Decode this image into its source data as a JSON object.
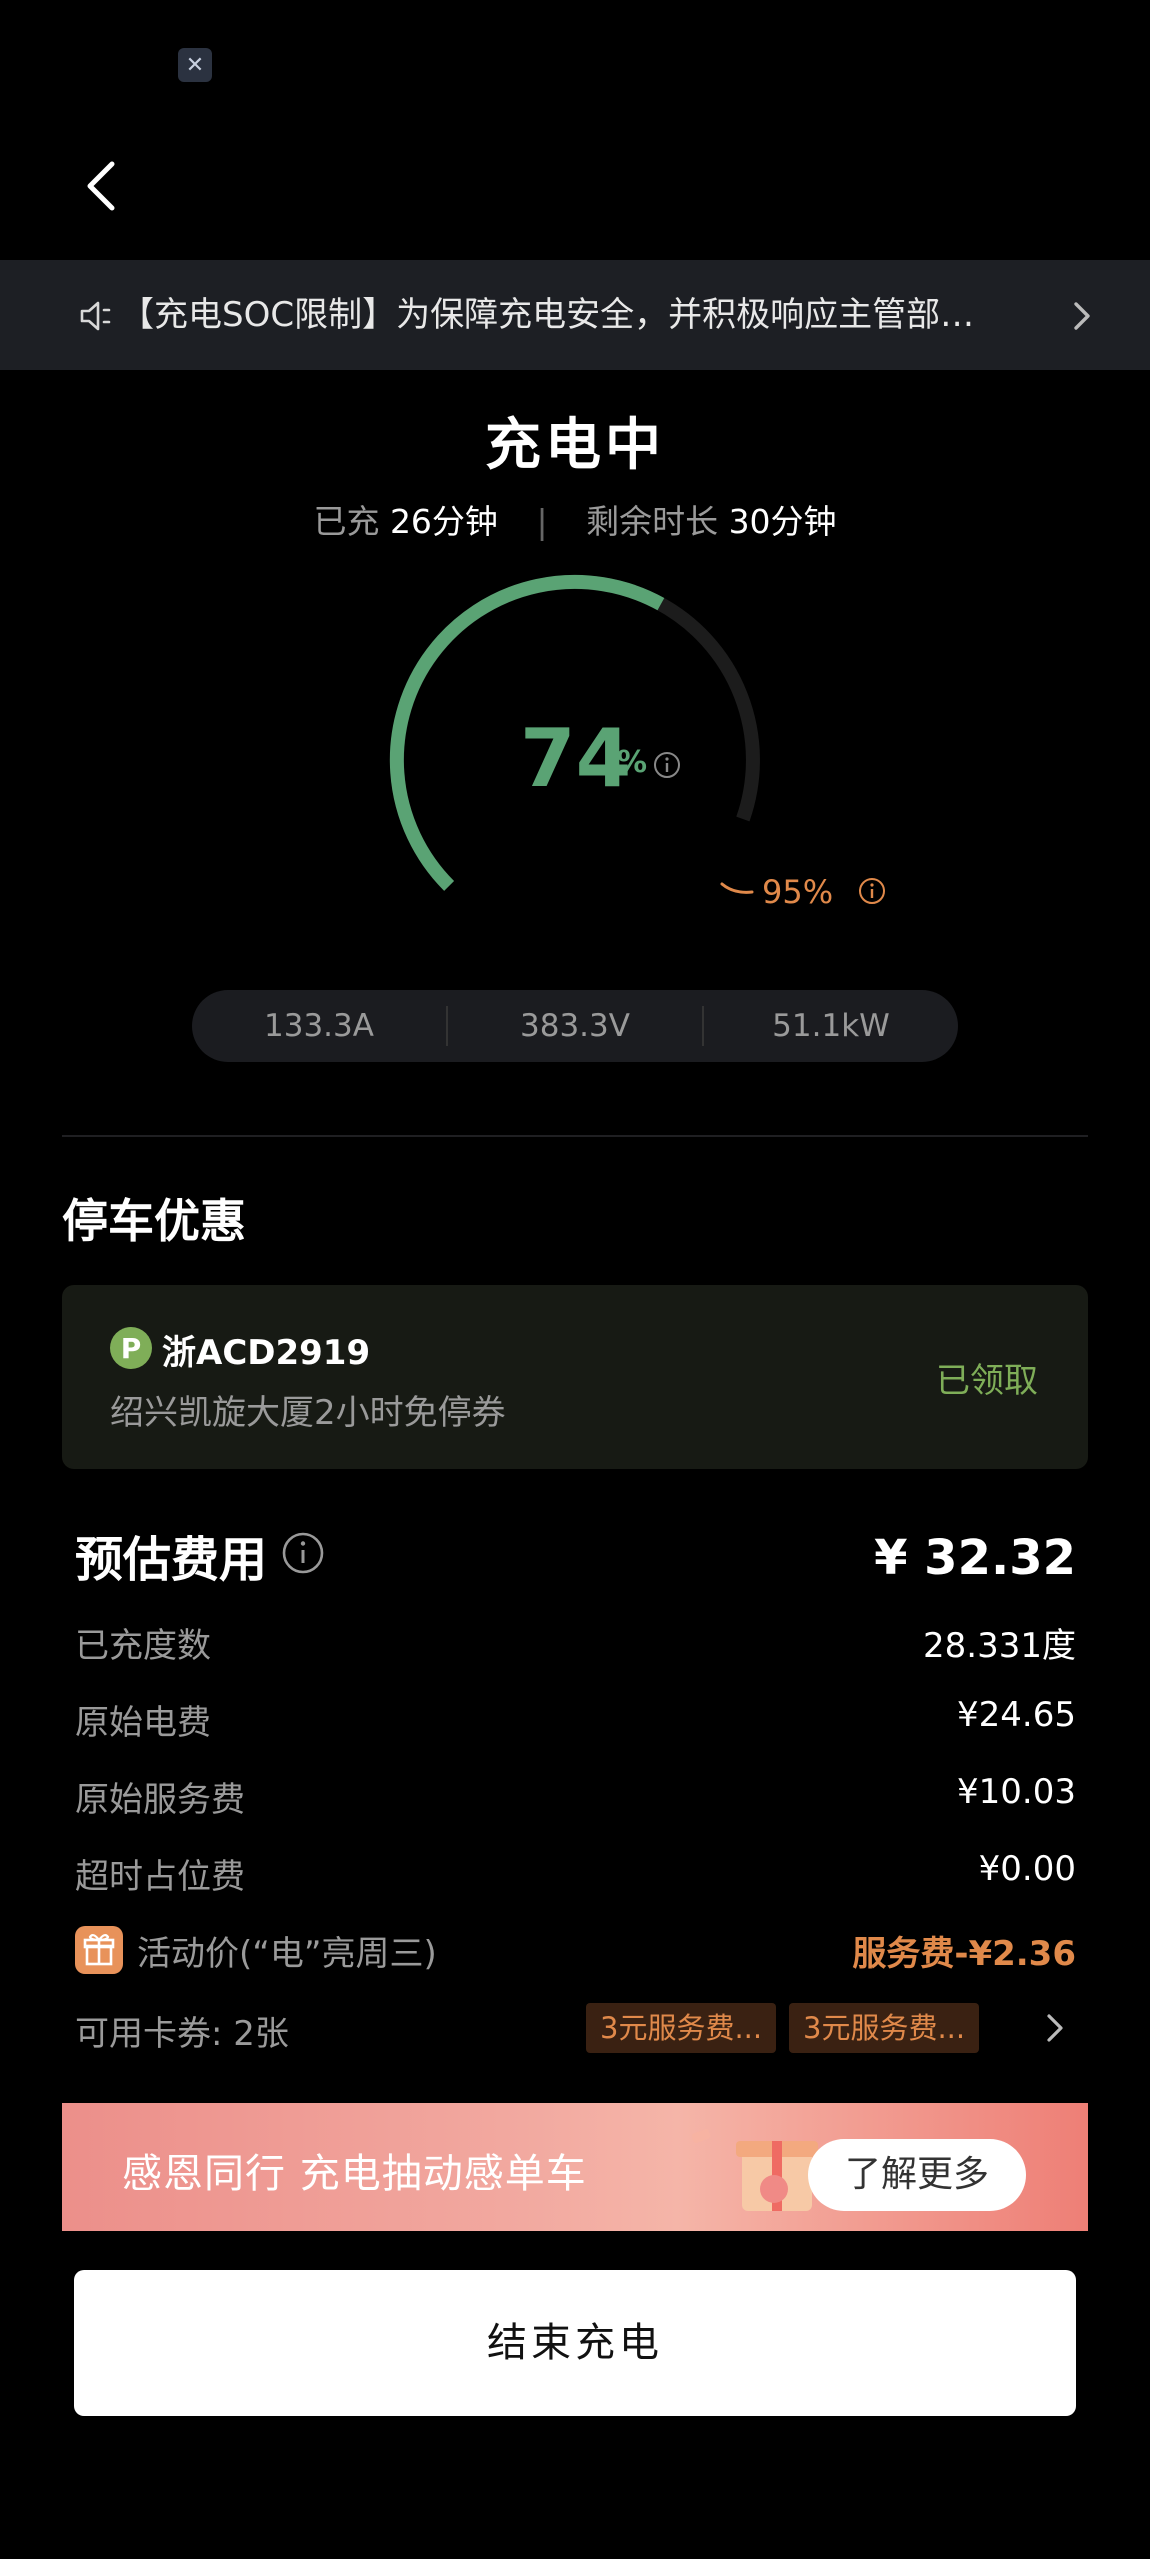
{
  "status_bar": {
    "app_icon": "close-x-icon"
  },
  "notice": {
    "text": "【充电SOC限制】为保障充电安全，并积极响应主管部…",
    "icons": {
      "leading": "speaker-icon",
      "trailing": "chevron-right-icon"
    }
  },
  "charging": {
    "status": "充电中",
    "charged_label": "已充",
    "charged_value": "26分钟",
    "separator": "|",
    "remaining_label": "剩余时长",
    "remaining_value": "30分钟",
    "soc_percent": 74,
    "soc_value": "74",
    "soc_unit": "%",
    "limit_percent": 95,
    "limit_text": "95%",
    "colors": {
      "progress": "#5aa374",
      "track": "#1c1c1c",
      "limit": "#e0894a"
    }
  },
  "metrics": {
    "current": "133.3A",
    "voltage": "383.3V",
    "power": "51.1kW"
  },
  "parking": {
    "title": "停车优惠",
    "badge": "P",
    "plate": "浙ACD2919",
    "coupon": "绍兴凯旋大厦2小时免停券",
    "status": "已领取"
  },
  "fees": {
    "title": "预估费用",
    "total": "¥ 32.32",
    "rows": [
      {
        "label": "已充度数",
        "value": "28.331度"
      },
      {
        "label": "原始电费",
        "value": "¥24.65"
      },
      {
        "label": "原始服务费",
        "value": "¥10.03"
      },
      {
        "label": "超时占位费",
        "value": "¥0.00"
      }
    ],
    "promo": {
      "label": "活动价(“电”亮周三)",
      "value": "服务费-¥2.36"
    },
    "coupons": {
      "label": "可用卡券: 2张",
      "chips": [
        "3元服务费...",
        "3元服务费..."
      ]
    }
  },
  "banner": {
    "text": "感恩同行 充电抽动感单车",
    "button": "了解更多"
  },
  "end_button": "结束充电"
}
